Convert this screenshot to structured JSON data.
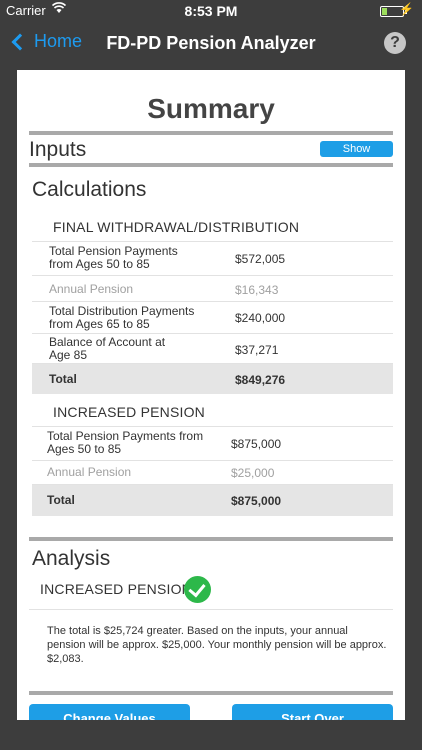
{
  "status_bar": {
    "carrier": "Carrier",
    "time": "8:53 PM"
  },
  "nav": {
    "back_label": "Home",
    "title": "FD-PD Pension Analyzer",
    "help": "?"
  },
  "summary": {
    "title": "Summary"
  },
  "inputs": {
    "label": "Inputs",
    "show_button": "Show"
  },
  "calculations": {
    "title": "Calculations",
    "final": {
      "title": "FINAL WITHDRAWAL/DISTRIBUTION",
      "rows": [
        {
          "label": "Total Pension Payments from Ages 50 to 85",
          "value": "$572,005"
        },
        {
          "label": "Annual Pension",
          "value": "$16,343"
        },
        {
          "label": "Total Distribution Payments from Ages 65 to 85",
          "value": "$240,000"
        },
        {
          "label": "Balance of Account at Age 85",
          "value": "$37,271"
        },
        {
          "label": "Total",
          "value": "$849,276"
        }
      ]
    },
    "increased": {
      "title": "INCREASED PENSION",
      "rows": [
        {
          "label": "Total Pension Payments from Ages 50 to 85",
          "value": "$875,000"
        },
        {
          "label": "Annual Pension",
          "value": "$25,000"
        },
        {
          "label": "Total",
          "value": "$875,000"
        }
      ]
    }
  },
  "analysis": {
    "title": "Analysis",
    "result_label": "INCREASED PENSION",
    "text": "The total is $25,724 greater.  Based on the inputs, your annual pension will be approx. $25,000.  Your monthly pension will be approx. $2,083."
  },
  "bottom_buttons": {
    "left": "Change Values",
    "right": "Start Over"
  },
  "colors": {
    "accent": "#1e9ee6",
    "check": "#2db84a",
    "bar": "#3d3d3d"
  }
}
